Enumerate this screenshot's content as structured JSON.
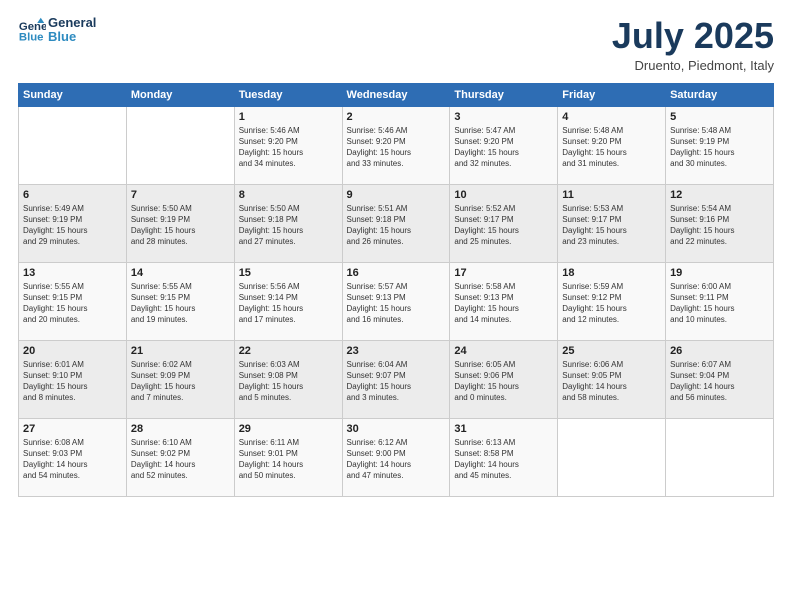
{
  "header": {
    "logo_line1": "General",
    "logo_line2": "Blue",
    "month_title": "July 2025",
    "location": "Druento, Piedmont, Italy"
  },
  "weekdays": [
    "Sunday",
    "Monday",
    "Tuesday",
    "Wednesday",
    "Thursday",
    "Friday",
    "Saturday"
  ],
  "weeks": [
    [
      {
        "day": "",
        "info": ""
      },
      {
        "day": "",
        "info": ""
      },
      {
        "day": "1",
        "info": "Sunrise: 5:46 AM\nSunset: 9:20 PM\nDaylight: 15 hours\nand 34 minutes."
      },
      {
        "day": "2",
        "info": "Sunrise: 5:46 AM\nSunset: 9:20 PM\nDaylight: 15 hours\nand 33 minutes."
      },
      {
        "day": "3",
        "info": "Sunrise: 5:47 AM\nSunset: 9:20 PM\nDaylight: 15 hours\nand 32 minutes."
      },
      {
        "day": "4",
        "info": "Sunrise: 5:48 AM\nSunset: 9:20 PM\nDaylight: 15 hours\nand 31 minutes."
      },
      {
        "day": "5",
        "info": "Sunrise: 5:48 AM\nSunset: 9:19 PM\nDaylight: 15 hours\nand 30 minutes."
      }
    ],
    [
      {
        "day": "6",
        "info": "Sunrise: 5:49 AM\nSunset: 9:19 PM\nDaylight: 15 hours\nand 29 minutes."
      },
      {
        "day": "7",
        "info": "Sunrise: 5:50 AM\nSunset: 9:19 PM\nDaylight: 15 hours\nand 28 minutes."
      },
      {
        "day": "8",
        "info": "Sunrise: 5:50 AM\nSunset: 9:18 PM\nDaylight: 15 hours\nand 27 minutes."
      },
      {
        "day": "9",
        "info": "Sunrise: 5:51 AM\nSunset: 9:18 PM\nDaylight: 15 hours\nand 26 minutes."
      },
      {
        "day": "10",
        "info": "Sunrise: 5:52 AM\nSunset: 9:17 PM\nDaylight: 15 hours\nand 25 minutes."
      },
      {
        "day": "11",
        "info": "Sunrise: 5:53 AM\nSunset: 9:17 PM\nDaylight: 15 hours\nand 23 minutes."
      },
      {
        "day": "12",
        "info": "Sunrise: 5:54 AM\nSunset: 9:16 PM\nDaylight: 15 hours\nand 22 minutes."
      }
    ],
    [
      {
        "day": "13",
        "info": "Sunrise: 5:55 AM\nSunset: 9:15 PM\nDaylight: 15 hours\nand 20 minutes."
      },
      {
        "day": "14",
        "info": "Sunrise: 5:55 AM\nSunset: 9:15 PM\nDaylight: 15 hours\nand 19 minutes."
      },
      {
        "day": "15",
        "info": "Sunrise: 5:56 AM\nSunset: 9:14 PM\nDaylight: 15 hours\nand 17 minutes."
      },
      {
        "day": "16",
        "info": "Sunrise: 5:57 AM\nSunset: 9:13 PM\nDaylight: 15 hours\nand 16 minutes."
      },
      {
        "day": "17",
        "info": "Sunrise: 5:58 AM\nSunset: 9:13 PM\nDaylight: 15 hours\nand 14 minutes."
      },
      {
        "day": "18",
        "info": "Sunrise: 5:59 AM\nSunset: 9:12 PM\nDaylight: 15 hours\nand 12 minutes."
      },
      {
        "day": "19",
        "info": "Sunrise: 6:00 AM\nSunset: 9:11 PM\nDaylight: 15 hours\nand 10 minutes."
      }
    ],
    [
      {
        "day": "20",
        "info": "Sunrise: 6:01 AM\nSunset: 9:10 PM\nDaylight: 15 hours\nand 8 minutes."
      },
      {
        "day": "21",
        "info": "Sunrise: 6:02 AM\nSunset: 9:09 PM\nDaylight: 15 hours\nand 7 minutes."
      },
      {
        "day": "22",
        "info": "Sunrise: 6:03 AM\nSunset: 9:08 PM\nDaylight: 15 hours\nand 5 minutes."
      },
      {
        "day": "23",
        "info": "Sunrise: 6:04 AM\nSunset: 9:07 PM\nDaylight: 15 hours\nand 3 minutes."
      },
      {
        "day": "24",
        "info": "Sunrise: 6:05 AM\nSunset: 9:06 PM\nDaylight: 15 hours\nand 0 minutes."
      },
      {
        "day": "25",
        "info": "Sunrise: 6:06 AM\nSunset: 9:05 PM\nDaylight: 14 hours\nand 58 minutes."
      },
      {
        "day": "26",
        "info": "Sunrise: 6:07 AM\nSunset: 9:04 PM\nDaylight: 14 hours\nand 56 minutes."
      }
    ],
    [
      {
        "day": "27",
        "info": "Sunrise: 6:08 AM\nSunset: 9:03 PM\nDaylight: 14 hours\nand 54 minutes."
      },
      {
        "day": "28",
        "info": "Sunrise: 6:10 AM\nSunset: 9:02 PM\nDaylight: 14 hours\nand 52 minutes."
      },
      {
        "day": "29",
        "info": "Sunrise: 6:11 AM\nSunset: 9:01 PM\nDaylight: 14 hours\nand 50 minutes."
      },
      {
        "day": "30",
        "info": "Sunrise: 6:12 AM\nSunset: 9:00 PM\nDaylight: 14 hours\nand 47 minutes."
      },
      {
        "day": "31",
        "info": "Sunrise: 6:13 AM\nSunset: 8:58 PM\nDaylight: 14 hours\nand 45 minutes."
      },
      {
        "day": "",
        "info": ""
      },
      {
        "day": "",
        "info": ""
      }
    ]
  ]
}
